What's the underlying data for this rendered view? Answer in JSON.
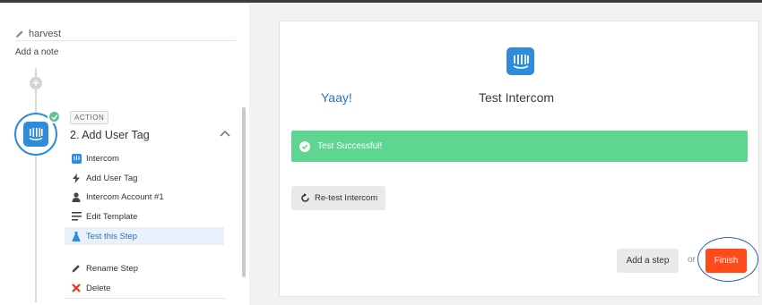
{
  "sidebar": {
    "zap_step_name": "harvest",
    "add_note_label": "Add a note",
    "action_tag": "ACTION",
    "step_title": "2. Add User Tag",
    "menu_items": [
      {
        "label": "Intercom",
        "icon": "intercom-icon"
      },
      {
        "label": "Add User Tag",
        "icon": "bolt-icon"
      },
      {
        "label": "Intercom Account #1",
        "icon": "user-icon"
      },
      {
        "label": "Edit Template",
        "icon": "list-icon"
      },
      {
        "label": "Test this Step",
        "icon": "flask-icon",
        "active": true
      }
    ],
    "extra_items": [
      {
        "label": "Rename Step",
        "icon": "pencil-icon"
      },
      {
        "label": "Delete",
        "icon": "x-icon"
      }
    ]
  },
  "main": {
    "yaay_text": "Yaay!",
    "test_title": "Test Intercom",
    "success_message": "Test Successful!",
    "retest_label": "Re-test Intercom",
    "add_step_label": "Add a step",
    "or_text": "or",
    "finish_label": "Finish"
  },
  "colors": {
    "accent_blue": "#2d8cdb",
    "success_green": "#5ed590",
    "finish_orange": "#ff4a1c",
    "highlight_ring": "#2f5fb4"
  }
}
